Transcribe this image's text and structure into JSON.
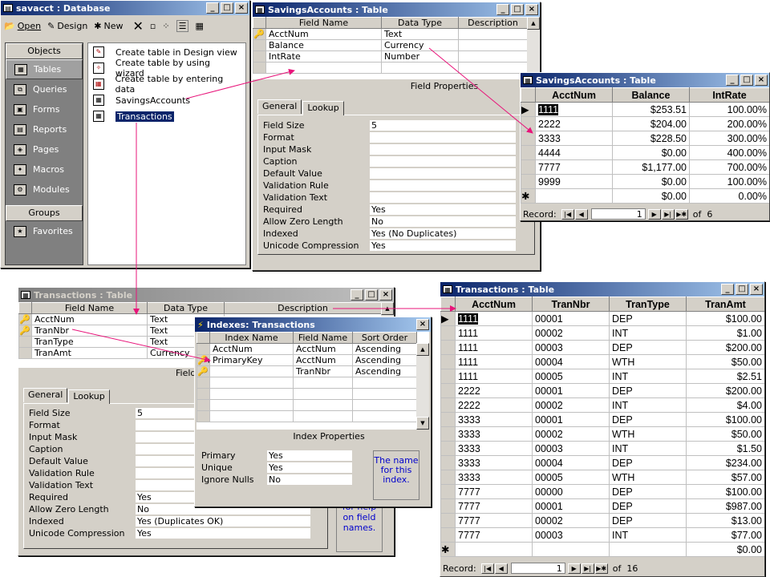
{
  "database": {
    "title": "savacct : Database",
    "toolbar": {
      "open": "Open",
      "design": "Design",
      "new": "New"
    },
    "objects_header": "Objects",
    "objects": [
      "Tables",
      "Queries",
      "Forms",
      "Reports",
      "Pages",
      "Macros",
      "Modules"
    ],
    "groups_header": "Groups",
    "groups": [
      "Favorites"
    ],
    "list": [
      "Create table in Design view",
      "Create table by using wizard",
      "Create table by entering data",
      "SavingsAccounts",
      "Transactions"
    ]
  },
  "sa_design": {
    "title": "SavingsAccounts : Table",
    "headers": [
      "Field Name",
      "Data Type",
      "Description"
    ],
    "rows": [
      [
        "AcctNum",
        "Text"
      ],
      [
        "Balance",
        "Currency"
      ],
      [
        "IntRate",
        "Number"
      ]
    ],
    "field_props_header": "Field Properties",
    "tabs": [
      "General",
      "Lookup"
    ],
    "props": [
      [
        "Field Size",
        "5"
      ],
      [
        "Format",
        ""
      ],
      [
        "Input Mask",
        ""
      ],
      [
        "Caption",
        ""
      ],
      [
        "Default Value",
        ""
      ],
      [
        "Validation Rule",
        ""
      ],
      [
        "Validation Text",
        ""
      ],
      [
        "Required",
        "Yes"
      ],
      [
        "Allow Zero Length",
        "No"
      ],
      [
        "Indexed",
        "Yes (No Duplicates)"
      ],
      [
        "Unicode Compression",
        "Yes"
      ]
    ]
  },
  "sa_data": {
    "title": "SavingsAccounts : Table",
    "headers": [
      "AcctNum",
      "Balance",
      "IntRate"
    ],
    "rows": [
      [
        "1111",
        "$253.51",
        "100.00%"
      ],
      [
        "2222",
        "$204.00",
        "200.00%"
      ],
      [
        "3333",
        "$228.50",
        "300.00%"
      ],
      [
        "4444",
        "$0.00",
        "400.00%"
      ],
      [
        "7777",
        "$1,177.00",
        "700.00%"
      ],
      [
        "9999",
        "$0.00",
        "100.00%"
      ]
    ],
    "new_row": [
      "",
      "$0.00",
      "0.00%"
    ],
    "nav": {
      "label": "Record:",
      "current": "1",
      "of": "of  6"
    }
  },
  "tr_design": {
    "title": "Transactions : Table",
    "headers": [
      "Field Name",
      "Data Type",
      "Description"
    ],
    "rows": [
      [
        "AcctNum",
        "Text"
      ],
      [
        "TranNbr",
        "Text"
      ],
      [
        "TranType",
        "Text"
      ],
      [
        "TranAmt",
        "Currency"
      ]
    ],
    "field_props_header": "Field",
    "tabs": [
      "General",
      "Lookup"
    ],
    "props": [
      [
        "Field Size",
        "5"
      ],
      [
        "Format",
        ""
      ],
      [
        "Input Mask",
        ""
      ],
      [
        "Caption",
        ""
      ],
      [
        "Default Value",
        ""
      ],
      [
        "Validation Rule",
        ""
      ],
      [
        "Validation Text",
        ""
      ],
      [
        "Required",
        "Yes"
      ],
      [
        "Allow Zero Length",
        "No"
      ],
      [
        "Indexed",
        "Yes (Duplicates OK)"
      ],
      [
        "Unicode Compression",
        "Yes"
      ]
    ],
    "help": "for help on field names."
  },
  "indexes": {
    "title": "Indexes: Transactions",
    "headers": [
      "Index Name",
      "Field Name",
      "Sort Order"
    ],
    "rows": [
      [
        "AcctNum",
        "AcctNum",
        "Ascending"
      ],
      [
        "PrimaryKey",
        "AcctNum",
        "Ascending"
      ],
      [
        "",
        "TranNbr",
        "Ascending"
      ]
    ],
    "props_header": "Index Properties",
    "props": [
      [
        "Primary",
        "Yes"
      ],
      [
        "Unique",
        "Yes"
      ],
      [
        "Ignore Nulls",
        "No"
      ]
    ],
    "help": "The name for this index."
  },
  "tr_data": {
    "title": "Transactions : Table",
    "headers": [
      "AcctNum",
      "TranNbr",
      "TranType",
      "TranAmt"
    ],
    "rows": [
      [
        "1111",
        "00001",
        "DEP",
        "$100.00"
      ],
      [
        "1111",
        "00002",
        "INT",
        "$1.00"
      ],
      [
        "1111",
        "00003",
        "DEP",
        "$200.00"
      ],
      [
        "1111",
        "00004",
        "WTH",
        "$50.00"
      ],
      [
        "1111",
        "00005",
        "INT",
        "$2.51"
      ],
      [
        "2222",
        "00001",
        "DEP",
        "$200.00"
      ],
      [
        "2222",
        "00002",
        "INT",
        "$4.00"
      ],
      [
        "3333",
        "00001",
        "DEP",
        "$100.00"
      ],
      [
        "3333",
        "00002",
        "WTH",
        "$50.00"
      ],
      [
        "3333",
        "00003",
        "INT",
        "$1.50"
      ],
      [
        "3333",
        "00004",
        "DEP",
        "$234.00"
      ],
      [
        "3333",
        "00005",
        "WTH",
        "$57.00"
      ],
      [
        "7777",
        "00000",
        "DEP",
        "$100.00"
      ],
      [
        "7777",
        "00001",
        "DEP",
        "$987.00"
      ],
      [
        "7777",
        "00002",
        "DEP",
        "$13.00"
      ],
      [
        "7777",
        "00003",
        "INT",
        "$77.00"
      ]
    ],
    "new_row": [
      "",
      "",
      "",
      "$0.00"
    ],
    "nav": {
      "label": "Record:",
      "current": "1",
      "of": "of  16"
    }
  },
  "colors": {
    "arrow": "#e8147a",
    "titlebar_active": "#0a246a",
    "help_text": "#0000cc",
    "selection": "#0a246a"
  }
}
